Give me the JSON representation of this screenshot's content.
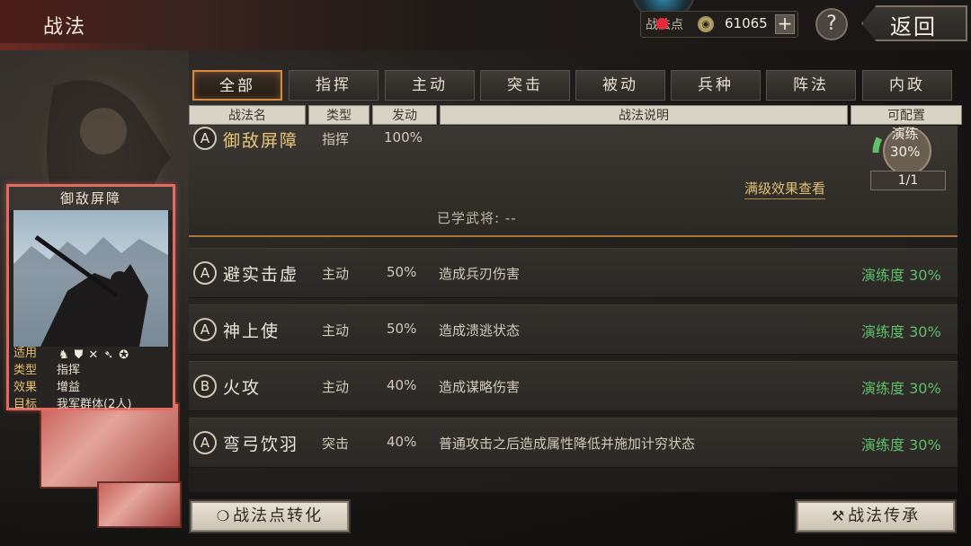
{
  "header": {
    "title": "战法",
    "points_label": "战法点",
    "points_value": "61065",
    "plus_label": "+",
    "help_label": "?",
    "back_label": "返回"
  },
  "tabs": [
    {
      "label": "全部",
      "active": true
    },
    {
      "label": "指挥",
      "active": false
    },
    {
      "label": "主动",
      "active": false
    },
    {
      "label": "突击",
      "active": false
    },
    {
      "label": "被动",
      "active": false
    },
    {
      "label": "兵种",
      "active": false
    },
    {
      "label": "阵法",
      "active": false
    },
    {
      "label": "内政",
      "active": false
    }
  ],
  "columns": [
    "战法名",
    "类型",
    "发动",
    "战法说明",
    "可配置"
  ],
  "expanded": {
    "grade": "A",
    "name": "御敌屏障",
    "type": "指挥",
    "rate": "100%",
    "drill_label": "演练",
    "drill_pct": "30%",
    "count": "1/1",
    "full_effect_link": "满级效果查看",
    "learned_label": "已学武将: --"
  },
  "rows": [
    {
      "grade": "A",
      "name": "避实击虚",
      "type": "主动",
      "rate": "50%",
      "desc": "造成兵刃伤害",
      "progress": "演练度 30%"
    },
    {
      "grade": "A",
      "name": "神上使",
      "type": "主动",
      "rate": "50%",
      "desc": "造成溃逃状态",
      "progress": "演练度 30%"
    },
    {
      "grade": "B",
      "name": "火攻",
      "type": "主动",
      "rate": "40%",
      "desc": "造成谋略伤害",
      "progress": "演练度 30%"
    },
    {
      "grade": "A",
      "name": "弯弓饮羽",
      "type": "突击",
      "rate": "40%",
      "desc": "普通攻击之后造成属性降低并施加计穷状态",
      "progress": "演练度 30%"
    }
  ],
  "card": {
    "title": "御敌屏障",
    "applies_label": "适用",
    "type_label": "类型",
    "type_value": "指挥",
    "effect_label": "效果",
    "effect_value": "增益",
    "target_label": "目标",
    "target_value": "我军群体(2人)",
    "unit_icons": [
      "cavalry-icon",
      "shield-icon",
      "bow-icon",
      "spear-icon",
      "wheel-icon"
    ]
  },
  "buttons": {
    "convert": "战法点转化",
    "inherit": "战法传承"
  },
  "colors": {
    "accent": "#d98a3e",
    "progress": "#5fbf6a",
    "card_border": "#e46b62",
    "link": "#e2c074"
  }
}
